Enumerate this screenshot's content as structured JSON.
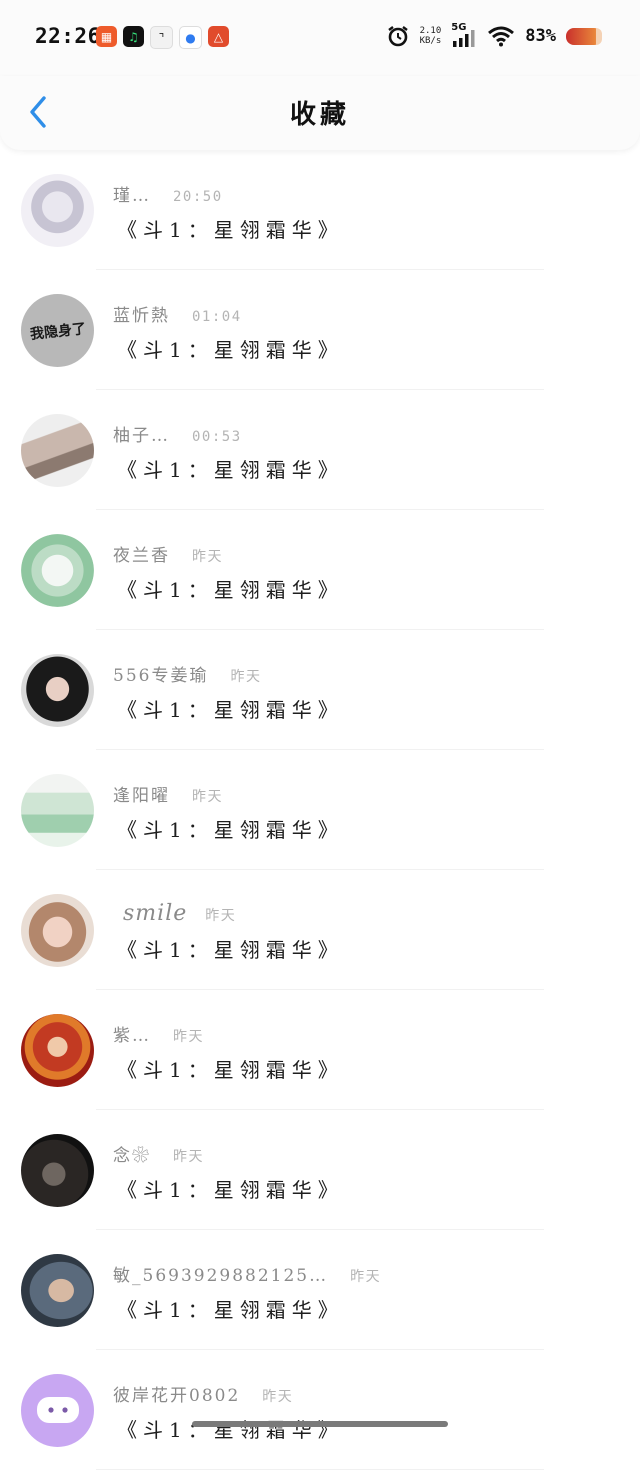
{
  "status_bar": {
    "time": "22:26",
    "speed_value": "2.10",
    "speed_unit": "KB/s",
    "network": "5G",
    "battery_percent": "83%",
    "icons": [
      "toutiao-app-icon",
      "music-app-icon",
      "clock-app-icon",
      "browser-app-icon",
      "game-app-icon",
      "alarm-icon",
      "signal-icon",
      "wifi-icon",
      "battery-icon"
    ]
  },
  "header": {
    "title": "收藏",
    "back_icon": "chevron-left-icon",
    "accent": "#2f8ee8"
  },
  "items": [
    {
      "name": "瑾…",
      "time": "20:50",
      "message": "《斗1：星翎霜华》",
      "avatar": "anime-girl-white-hair"
    },
    {
      "name": "蓝忻熱",
      "time": "01:04",
      "message": "《斗1：星翎霜华》",
      "avatar": "text-avatar",
      "avatar_text": "我隐身了"
    },
    {
      "name": "柚子…",
      "time": "00:53",
      "message": "《斗1：星翎霜华》",
      "avatar": "sleeping-girl"
    },
    {
      "name": "夜兰香",
      "time": "昨天",
      "message": "《斗1：星翎霜华》",
      "avatar": "anime-girl-green"
    },
    {
      "name": "556专姜瑜",
      "time": "昨天",
      "message": "《斗1：星翎霜华》",
      "avatar": "girl-dark-hair"
    },
    {
      "name": "逢阳曜",
      "time": "昨天",
      "message": "《斗1：星翎霜华》",
      "avatar": "group-photo"
    },
    {
      "name": "smile",
      "time": "昨天",
      "message": "《斗1：星翎霜华》",
      "avatar": "girl-portrait"
    },
    {
      "name": "紫…",
      "time": "昨天",
      "message": "《斗1：星翎霜华》",
      "avatar": "anime-red-costume"
    },
    {
      "name": "念❀",
      "time": "昨天",
      "message": "《斗1：星翎霜华》",
      "avatar": "dark-photo"
    },
    {
      "name": "敏_5693929882125…",
      "time": "昨天",
      "message": "《斗1：星翎霜华》",
      "avatar": "child-photo"
    },
    {
      "name": "彼岸花开0802",
      "time": "昨天",
      "message": "《斗1：星翎霜华》",
      "avatar": "purple-cartoon"
    }
  ]
}
